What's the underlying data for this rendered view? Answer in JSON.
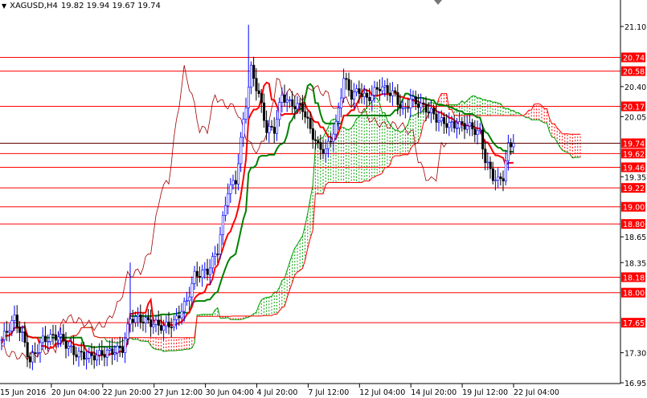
{
  "header": {
    "symbol": "XAGUSD,H4",
    "ohlc": "19.82 19.94 19.67 19.74"
  },
  "colors": {
    "bull": "#0000ff",
    "bear": "#ff0000",
    "level": "#ff0000",
    "tenkan": "#ff0000",
    "kijun": "#008000",
    "chikou": "#a00000",
    "cloud_up": "#00a000",
    "cloud_down": "#ff0000"
  },
  "chart_data": {
    "type": "candlestick",
    "title": "XAGUSD,H4",
    "ylim": [
      16.95,
      21.1
    ],
    "y_ticks": [
      "21.10",
      "20.40",
      "20.05",
      "19.35",
      "18.65",
      "18.35",
      "17.30",
      "16.95"
    ],
    "x_ticks": [
      "15 Jun 2016",
      "20 Jun 04:00",
      "22 Jun 20:00",
      "27 Jun 12:00",
      "30 Jun 04:00",
      "4 Jul 20:00",
      "7 Jul 12:00",
      "12 Jul 04:00",
      "14 Jul 20:00",
      "19 Jul 12:00",
      "22 Jul 04:00"
    ],
    "levels": [
      "20.74",
      "20.58",
      "20.17",
      "19.74",
      "19.62",
      "19.46",
      "19.22",
      "19.00",
      "18.80",
      "18.18",
      "18.00",
      "17.65"
    ],
    "close_keypoints": [
      [
        0,
        17.45
      ],
      [
        5,
        17.7
      ],
      [
        8,
        17.5
      ],
      [
        11,
        17.2
      ],
      [
        16,
        17.45
      ],
      [
        22,
        17.5
      ],
      [
        28,
        17.3
      ],
      [
        34,
        17.25
      ],
      [
        41,
        17.3
      ],
      [
        47,
        17.35
      ],
      [
        50,
        17.7
      ],
      [
        53,
        17.7
      ],
      [
        63,
        17.6
      ],
      [
        67,
        17.65
      ],
      [
        72,
        17.9
      ],
      [
        75,
        18.2
      ],
      [
        80,
        18.25
      ],
      [
        84,
        18.5
      ],
      [
        88,
        19.2
      ],
      [
        91,
        19.3
      ],
      [
        94,
        20.0
      ],
      [
        95,
        20.2
      ],
      [
        97,
        20.6
      ],
      [
        100,
        20.3
      ],
      [
        103,
        19.9
      ],
      [
        106,
        19.9
      ],
      [
        109,
        20.3
      ],
      [
        112,
        20.2
      ],
      [
        117,
        20.15
      ],
      [
        120,
        19.9
      ],
      [
        123,
        19.7
      ],
      [
        126,
        19.65
      ],
      [
        130,
        19.95
      ],
      [
        133,
        20.5
      ],
      [
        136,
        20.3
      ],
      [
        139,
        20.35
      ],
      [
        142,
        20.25
      ],
      [
        147,
        20.4
      ],
      [
        153,
        20.3
      ],
      [
        156,
        20.1
      ],
      [
        159,
        20.25
      ],
      [
        162,
        20.2
      ],
      [
        167,
        20.1
      ],
      [
        170,
        20.0
      ],
      [
        175,
        19.95
      ],
      [
        181,
        19.95
      ],
      [
        186,
        19.85
      ],
      [
        188,
        19.55
      ],
      [
        191,
        19.35
      ],
      [
        193,
        19.3
      ],
      [
        195,
        19.35
      ],
      [
        197,
        19.7
      ],
      [
        199,
        19.74
      ]
    ]
  }
}
